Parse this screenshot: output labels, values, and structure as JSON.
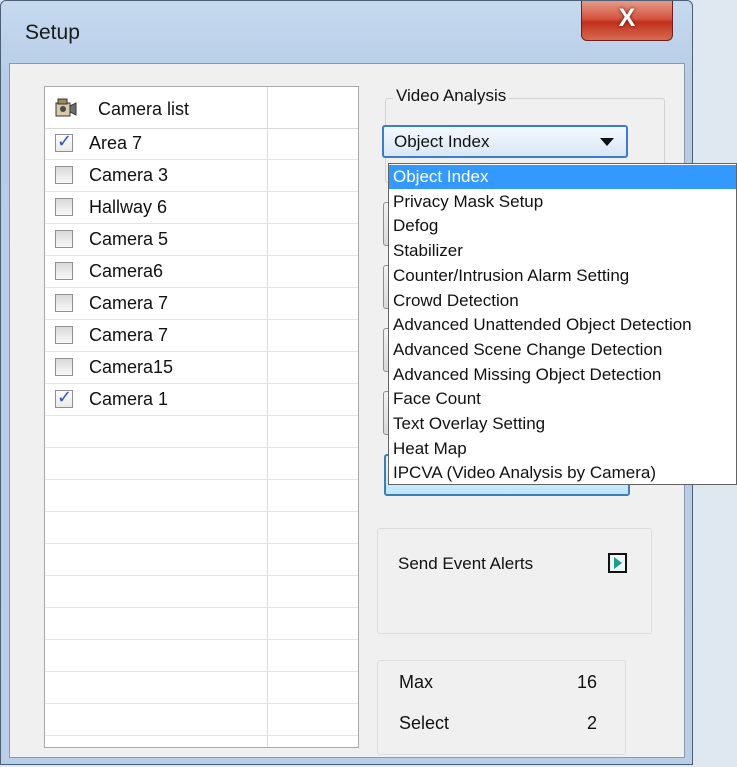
{
  "window": {
    "title": "Setup",
    "close_glyph": "X"
  },
  "camera_list": {
    "header": "Camera list",
    "header_icon": "camera-icon",
    "items": [
      {
        "label": "Area 7",
        "checked": true
      },
      {
        "label": "Camera 3",
        "checked": false
      },
      {
        "label": "Hallway 6",
        "checked": false
      },
      {
        "label": "Camera 5",
        "checked": false
      },
      {
        "label": "Camera6",
        "checked": false
      },
      {
        "label": "Camera 7",
        "checked": false
      },
      {
        "label": "Camera 7",
        "checked": false
      },
      {
        "label": "Camera15",
        "checked": false
      },
      {
        "label": "Camera 1",
        "checked": true
      }
    ]
  },
  "video_analysis": {
    "group_label": "Video Analysis",
    "selected": "Object Index",
    "options": [
      "Object Index",
      "Privacy Mask Setup",
      "Defog",
      "Stabilizer",
      "Counter/Intrusion Alarm Setting",
      "Crowd Detection",
      "Advanced Unattended Object Detection",
      "Advanced Scene Change Detection",
      "Advanced Missing Object Detection",
      "Face Count",
      "Text Overlay Setting",
      "Heat Map",
      "IPCVA (Video Analysis by Camera)"
    ]
  },
  "alerts": {
    "label": "Send Event Alerts",
    "icon": "play-icon"
  },
  "counts": {
    "max_label": "Max",
    "max_value": "16",
    "select_label": "Select",
    "select_value": "2"
  },
  "colors": {
    "selection": "#3399ff",
    "check": "#2c56b7",
    "close": "#c9412b"
  }
}
